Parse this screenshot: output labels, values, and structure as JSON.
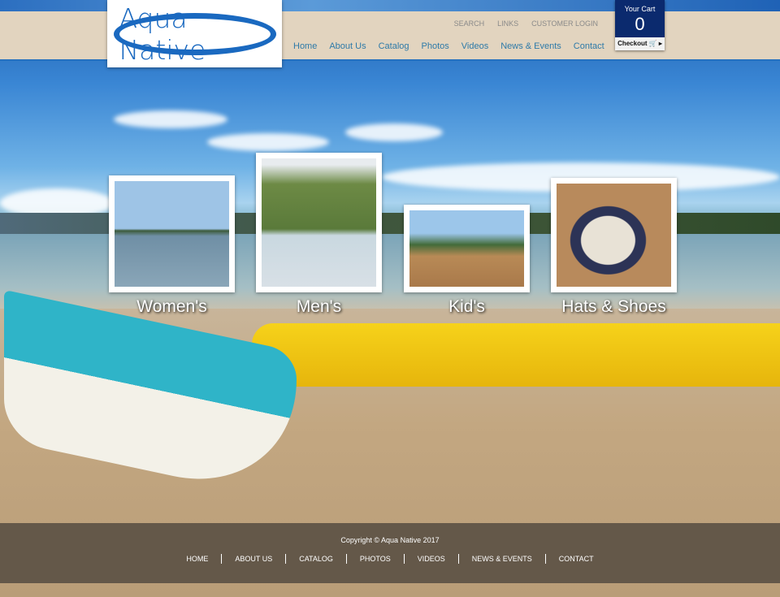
{
  "brand": {
    "name": "Aqua Native"
  },
  "utility_links": [
    "SEARCH",
    "LINKS",
    "CUSTOMER LOGIN"
  ],
  "nav": [
    "Home",
    "About Us",
    "Catalog",
    "Photos",
    "Videos",
    "News & Events",
    "Contact"
  ],
  "cart": {
    "title": "Your Cart",
    "count": "0",
    "checkout": "Checkout 🛒 ▸"
  },
  "categories": [
    {
      "label": "Women's"
    },
    {
      "label": "Men's"
    },
    {
      "label": "Kid's"
    },
    {
      "label": "Hats & Shoes"
    }
  ],
  "footer": {
    "copyright": "Copyright © Aqua Native 2017",
    "links": [
      "HOME",
      "ABOUT US",
      "CATALOG",
      "PHOTOS",
      "VIDEOS",
      "NEWS & EVENTS",
      "CONTACT"
    ]
  },
  "colors": {
    "brand_blue": "#1a69c0",
    "cart_navy": "#0b2a6e",
    "header_beige": "#e2d4bf",
    "nav_link": "#2e7aa8"
  }
}
